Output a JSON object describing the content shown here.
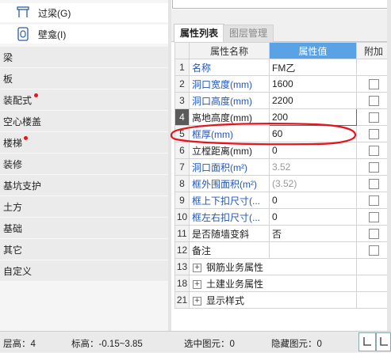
{
  "left": {
    "tools": [
      {
        "label": "过梁(G)",
        "icon": "lintel-icon"
      },
      {
        "label": "壁龛(I)",
        "icon": "niche-icon"
      }
    ],
    "categories": [
      {
        "label": "梁",
        "dot": false
      },
      {
        "label": "板",
        "dot": false
      },
      {
        "label": "装配式",
        "dot": true
      },
      {
        "label": "空心楼盖",
        "dot": false
      },
      {
        "label": "楼梯",
        "dot": true
      },
      {
        "label": "装修",
        "dot": false
      },
      {
        "label": "基坑支护",
        "dot": false
      },
      {
        "label": "土方",
        "dot": false
      },
      {
        "label": "基础",
        "dot": false
      },
      {
        "label": "其它",
        "dot": false
      },
      {
        "label": "自定义",
        "dot": false
      }
    ]
  },
  "tabs": {
    "active": "属性列表",
    "inactive": "图层管理"
  },
  "table": {
    "headers": {
      "name": "属性名称",
      "value": "属性值",
      "attach": "附加"
    },
    "rows": [
      {
        "num": "1",
        "name": "名称",
        "value": "FM乙",
        "style": "blue",
        "checkbox": false
      },
      {
        "num": "2",
        "name": "洞口宽度(mm)",
        "value": "1600",
        "style": "blue",
        "checkbox": true
      },
      {
        "num": "3",
        "name": "洞口高度(mm)",
        "value": "2200",
        "style": "blue",
        "checkbox": true
      },
      {
        "num": "4",
        "name": "离地高度(mm)",
        "value": "200",
        "style": "black",
        "checkbox": true,
        "selected": true
      },
      {
        "num": "5",
        "name": "框厚(mm)",
        "value": "60",
        "style": "blue",
        "checkbox": true
      },
      {
        "num": "6",
        "name": "立樘距离(mm)",
        "value": "0",
        "style": "black",
        "checkbox": true
      },
      {
        "num": "7",
        "name": "洞口面积(m²)",
        "value": "3.52",
        "style": "blue",
        "checkbox": true,
        "gray": true
      },
      {
        "num": "8",
        "name": "框外围面积(m²)",
        "value": "(3.52)",
        "style": "blue",
        "checkbox": true,
        "gray": true
      },
      {
        "num": "9",
        "name": "框上下扣尺寸(...",
        "value": "0",
        "style": "blue",
        "checkbox": true
      },
      {
        "num": "10",
        "name": "框左右扣尺寸(...",
        "value": "0",
        "style": "blue",
        "checkbox": true
      },
      {
        "num": "11",
        "name": "是否随墙变斜",
        "value": "否",
        "style": "black",
        "checkbox": true
      },
      {
        "num": "12",
        "name": "备注",
        "value": "",
        "style": "black",
        "checkbox": true
      }
    ],
    "groups": [
      {
        "num": "13",
        "label": "钢筋业务属性"
      },
      {
        "num": "18",
        "label": "土建业务属性"
      },
      {
        "num": "21",
        "label": "显示样式"
      }
    ]
  },
  "status": {
    "floor": "层高：4",
    "elev": "标高：-0.15~3.85",
    "selected": "选中图元：0",
    "hidden": "隐藏图元：0"
  },
  "colors": {
    "accent": "#5aa2e6",
    "blue_text": "#2356b8",
    "annotation": "#e8141d"
  }
}
